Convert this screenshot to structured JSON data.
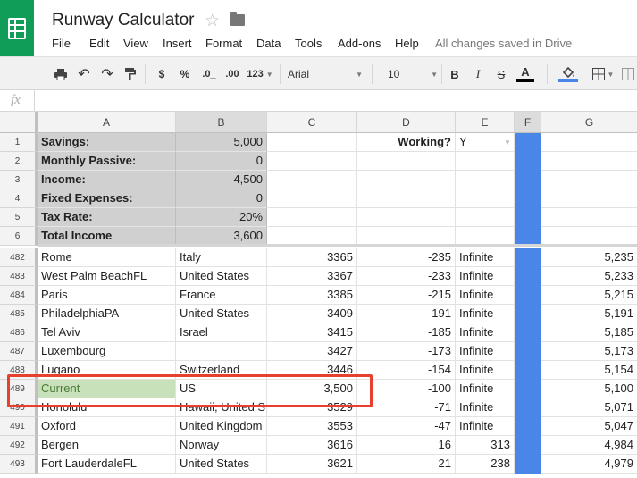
{
  "doc": {
    "title": "Runway Calculator",
    "saved_status": "All changes saved in Drive"
  },
  "menu": [
    "File",
    "Edit",
    "View",
    "Insert",
    "Format",
    "Data",
    "Tools",
    "Add-ons",
    "Help"
  ],
  "toolbar": {
    "currency": "$",
    "percent": "%",
    "dec_decrease": ".0_",
    "dec_increase": ".00",
    "more_formats": "123",
    "font": "Arial",
    "size": "10",
    "bold": "B",
    "italic": "I",
    "strike": "S",
    "text_color_label": "A",
    "text_color": "#000000",
    "fill_color": "#4a86e8"
  },
  "formula_bar": {
    "fx": "fx",
    "value": ""
  },
  "columns": [
    "A",
    "B",
    "C",
    "D",
    "E",
    "F",
    "G"
  ],
  "frozen_rows": [
    {
      "n": "1",
      "A": "Savings:",
      "B": "5,000",
      "C": "",
      "D": "Working?",
      "E": "Y",
      "G": ""
    },
    {
      "n": "2",
      "A": "Monthly Passive:",
      "B": "0",
      "C": "",
      "D": "",
      "E": "",
      "G": ""
    },
    {
      "n": "3",
      "A": "Income:",
      "B": "4,500",
      "C": "",
      "D": "",
      "E": "",
      "G": ""
    },
    {
      "n": "4",
      "A": "Fixed Expenses:",
      "B": "0",
      "C": "",
      "D": "",
      "E": "",
      "G": ""
    },
    {
      "n": "5",
      "A": "Tax Rate:",
      "B": "20%",
      "C": "",
      "D": "",
      "E": "",
      "G": ""
    },
    {
      "n": "6",
      "A": "Total Income",
      "B": "3,600",
      "C": "",
      "D": "",
      "E": "",
      "G": ""
    }
  ],
  "rows": [
    {
      "n": "482",
      "A": "Rome",
      "B": "Italy",
      "C": "3365",
      "D": "-235",
      "E": "Infinite",
      "G": "5,235"
    },
    {
      "n": "483",
      "A": "West Palm BeachFL",
      "B": "United States",
      "C": "3367",
      "D": "-233",
      "E": "Infinite",
      "G": "5,233"
    },
    {
      "n": "484",
      "A": "Paris",
      "B": "France",
      "C": "3385",
      "D": "-215",
      "E": "Infinite",
      "G": "5,215"
    },
    {
      "n": "485",
      "A": "PhiladelphiaPA",
      "B": "United States",
      "C": "3409",
      "D": "-191",
      "E": "Infinite",
      "G": "5,191"
    },
    {
      "n": "486",
      "A": "Tel Aviv",
      "B": "Israel",
      "C": "3415",
      "D": "-185",
      "E": "Infinite",
      "G": "5,185"
    },
    {
      "n": "487",
      "A": "Luxembourg",
      "B": "",
      "C": "3427",
      "D": "-173",
      "E": "Infinite",
      "G": "5,173"
    },
    {
      "n": "488",
      "A": "Lugano",
      "B": "Switzerland",
      "C": "3446",
      "D": "-154",
      "E": "Infinite",
      "G": "5,154"
    },
    {
      "n": "489",
      "A": "Current",
      "B": "US",
      "C": "3,500",
      "D": "-100",
      "E": "Infinite",
      "G": "5,100"
    },
    {
      "n": "490",
      "A": "Honolulu",
      "B": "Hawaii, United S",
      "C": "3529",
      "D": "-71",
      "E": "Infinite",
      "G": "5,071"
    },
    {
      "n": "491",
      "A": "Oxford",
      "B": "United Kingdom",
      "C": "3553",
      "D": "-47",
      "E": "Infinite",
      "G": "5,047"
    },
    {
      "n": "492",
      "A": "Bergen",
      "B": "Norway",
      "C": "3616",
      "D": "16",
      "E": "313",
      "G": "4,984"
    },
    {
      "n": "493",
      "A": "Fort LauderdaleFL",
      "B": "United States",
      "C": "3621",
      "D": "21",
      "E": "238",
      "G": "4,979"
    }
  ],
  "colors": {
    "frozen_fill": "#d0d0d0",
    "column_f_fill": "#4a86e8",
    "current_fill": "#c9e1bb",
    "highlight_border": "#e8402e"
  }
}
